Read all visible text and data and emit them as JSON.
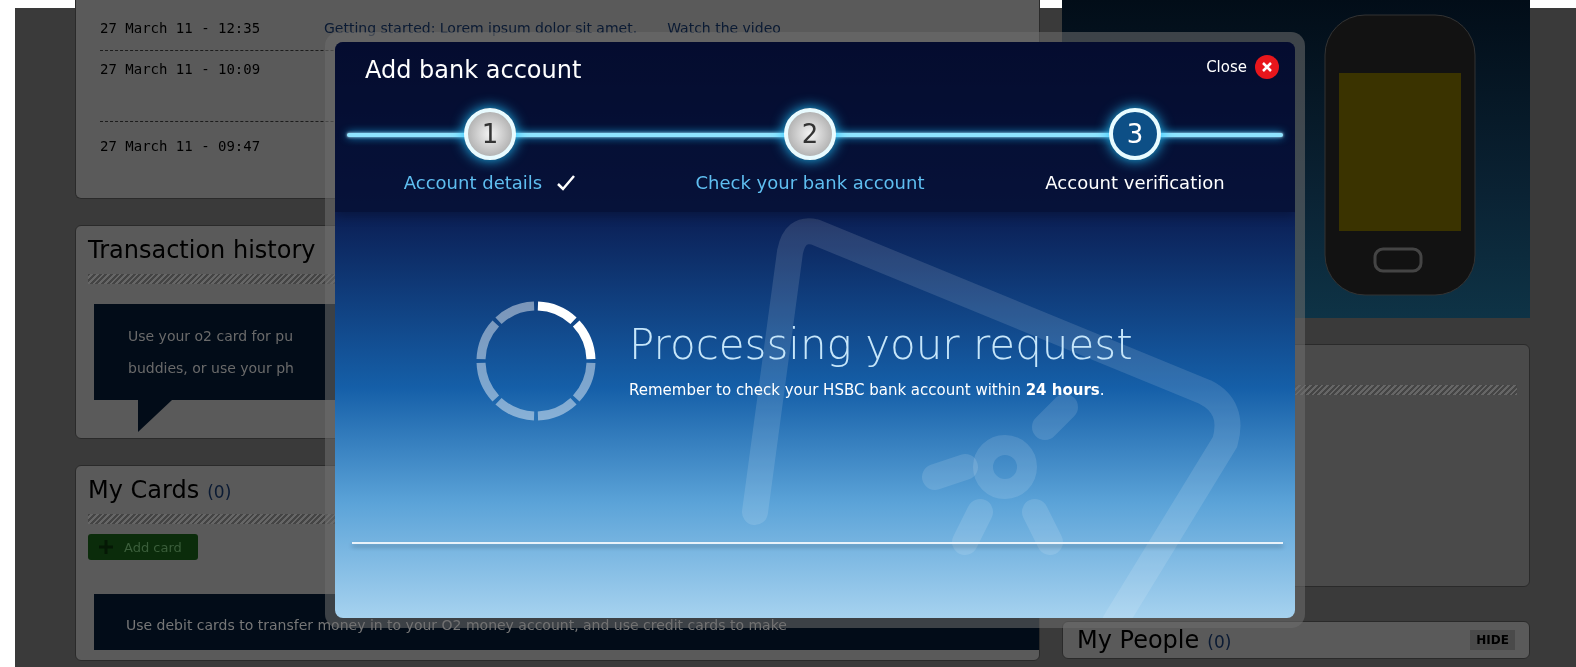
{
  "activity": {
    "rows": [
      {
        "time": "27 March 11 - 12:35",
        "text": "Getting started: Lorem ipsum dolor sit amet.",
        "link": "Watch the video"
      },
      {
        "time": "27 March 11 - 10:09"
      },
      {
        "time": "27 March 11 - 09:47"
      }
    ]
  },
  "transaction_history": {
    "title": "Transaction history",
    "lines": [
      "Use your o2 card for pu",
      "buddies, or use your ph"
    ]
  },
  "my_cards": {
    "title": "My Cards",
    "count": "(0)",
    "add_button": "Add card",
    "info": "Use debit cards to transfer money in to your O2 money account, and use credit cards to make"
  },
  "my_people": {
    "title": "My People",
    "count": "(0)",
    "hide_button": "HIDE"
  },
  "modal": {
    "title": "Add bank account",
    "close": "Close",
    "steps": [
      {
        "number": "1",
        "label": "Account details",
        "checked": true,
        "selected": false
      },
      {
        "number": "2",
        "label": "Check your bank account",
        "checked": false,
        "selected": false
      },
      {
        "number": "3",
        "label": "Account verification",
        "checked": false,
        "selected": true
      }
    ],
    "heading": "Processing your request",
    "message": "Remember to check your HSBC bank account within **24 hours**."
  }
}
